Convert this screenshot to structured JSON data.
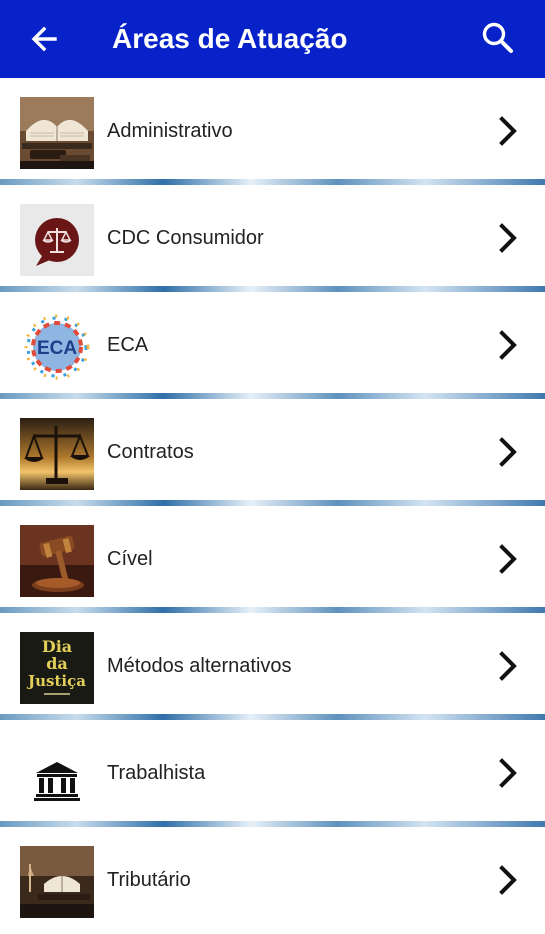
{
  "appbar": {
    "title": "Áreas de Atuação",
    "back_icon": "arrow-left-icon",
    "search_icon": "search-icon",
    "background_color": "#0722c8"
  },
  "items": [
    {
      "label": "Administrativo",
      "icon": "open-book-gavel-image"
    },
    {
      "label": "CDC Consumidor",
      "icon": "scales-speech-bubble-image"
    },
    {
      "label": "ECA",
      "icon": "children-circle-eca-image"
    },
    {
      "label": "Contratos",
      "icon": "scales-sunset-image"
    },
    {
      "label": "Cível",
      "icon": "gavel-image"
    },
    {
      "label": "Métodos alternativos",
      "icon": "dia-da-justica-image",
      "image_text": [
        "Dia",
        "da",
        "Justiça"
      ]
    },
    {
      "label": "Trabalhista",
      "icon": "courthouse-icon"
    },
    {
      "label": "Tributário",
      "icon": "book-justice-statue-image"
    }
  ],
  "chevron_icon": "chevron-right-icon"
}
